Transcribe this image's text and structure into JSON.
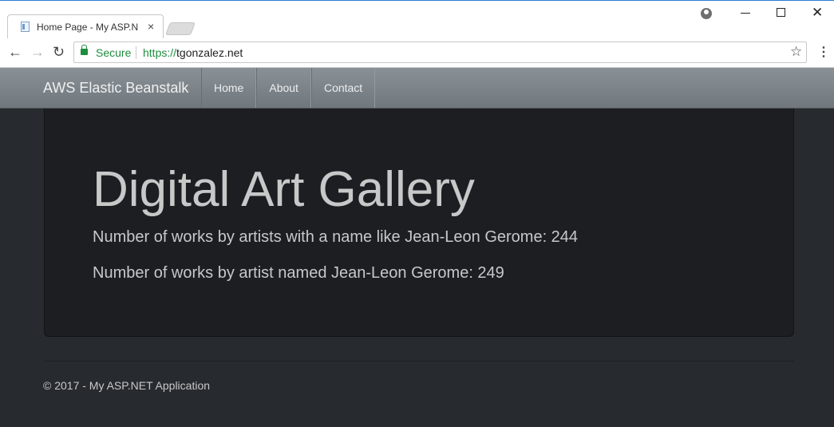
{
  "browser": {
    "tab_title": "Home Page - My ASP.NE",
    "tab_close": "×",
    "secure_label": "Secure",
    "url_scheme": "https://",
    "url_host": "tgonzalez.net",
    "icons": {
      "back": "←",
      "forward": "→",
      "reload": "↻",
      "star": "☆",
      "menu": "⋮",
      "close_window": "✕"
    }
  },
  "navbar": {
    "brand": "AWS Elastic Beanstalk",
    "items": [
      {
        "label": "Home"
      },
      {
        "label": "About"
      },
      {
        "label": "Contact"
      }
    ]
  },
  "jumbotron": {
    "title": "Digital Art Gallery",
    "stat_like": "Number of works by artists with a name like Jean-Leon Gerome: 244",
    "stat_named": "Number of works by artist named Jean-Leon Gerome: 249"
  },
  "footer": {
    "text": "© 2017 - My ASP.NET Application"
  },
  "colors": {
    "page_background": "#272b30",
    "jumbotron_background": "#1c1e22",
    "navbar_background": "#7a8288",
    "text": "#c8c8c8",
    "secure_green": "#1e8e3e"
  }
}
